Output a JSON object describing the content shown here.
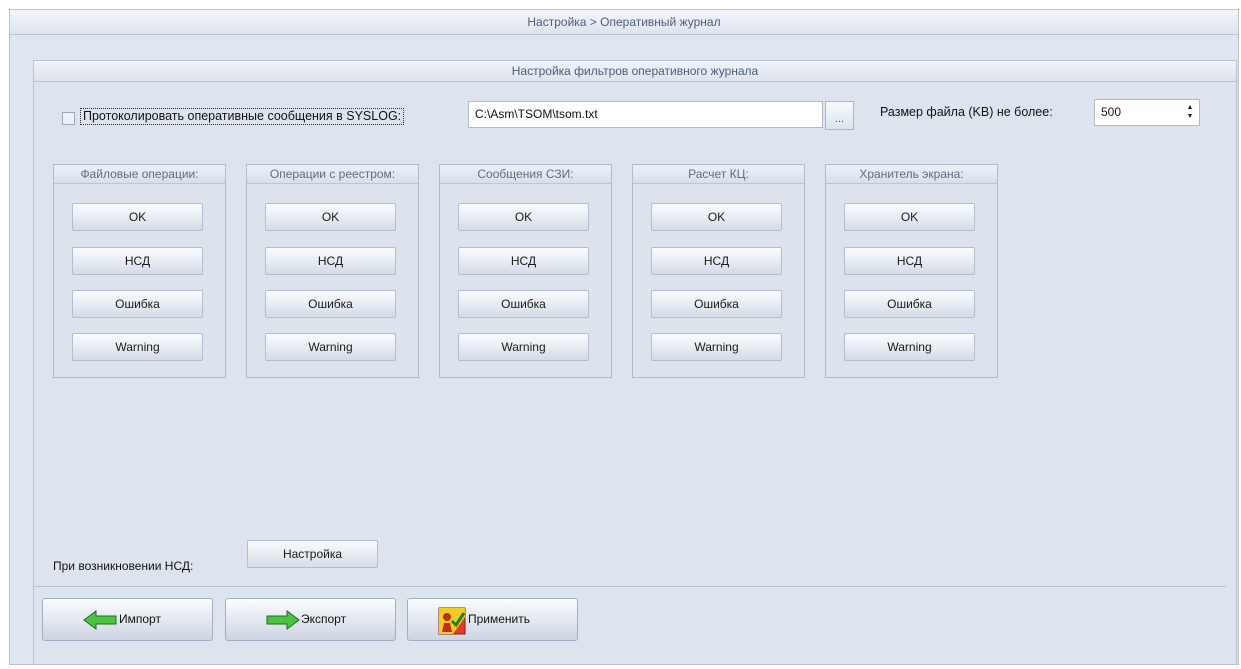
{
  "window": {
    "title": "Настройка > Оперативный журнал"
  },
  "panel": {
    "title": "Настройка фильтров оперативного журнала"
  },
  "syslog": {
    "checked": false,
    "label": "Протоколировать оперативные сообщения в SYSLOG:",
    "path": "C:\\Asm\\TSOM\\tsom.txt",
    "browse_label": "..."
  },
  "file_size": {
    "label": "Размер файла (KB) не более:",
    "value": "500"
  },
  "groups": [
    {
      "title": "Файловые операции:",
      "buttons": [
        "OK",
        "НСД",
        "Ошибка",
        "Warning"
      ]
    },
    {
      "title": "Операции с реестром:",
      "buttons": [
        "OK",
        "НСД",
        "Ошибка",
        "Warning"
      ]
    },
    {
      "title": "Сообщения СЗИ:",
      "buttons": [
        "OK",
        "НСД",
        "Ошибка",
        "Warning"
      ]
    },
    {
      "title": "Расчет КЦ:",
      "buttons": [
        "OK",
        "НСД",
        "Ошибка",
        "Warning"
      ]
    },
    {
      "title": "Хранитель экрана:",
      "buttons": [
        "OK",
        "НСД",
        "Ошибка",
        "Warning"
      ]
    }
  ],
  "nsd": {
    "label": "При возникновении НСД:",
    "button": "Настройка"
  },
  "actions": {
    "import": "Импорт",
    "export": "Экспорт",
    "apply": "Применить"
  }
}
